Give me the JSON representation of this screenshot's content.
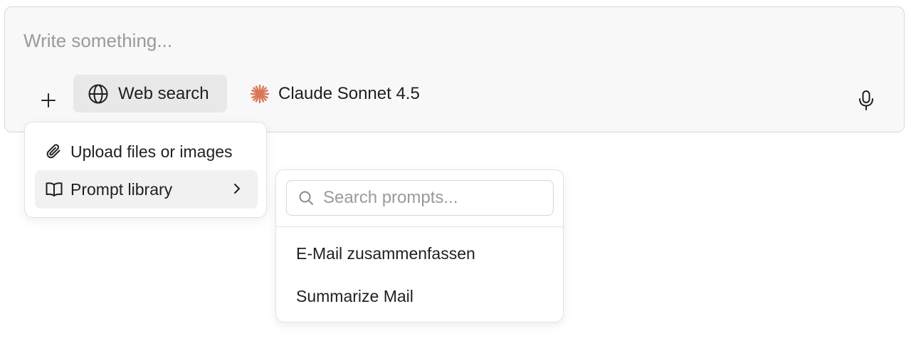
{
  "composer": {
    "placeholder": "Write something...",
    "value": ""
  },
  "toolbar": {
    "add_icon": "plus-icon",
    "web_search_label": "Web search",
    "web_search_icon": "globe-icon",
    "model_label": "Claude Sonnet 4.5",
    "model_icon": "claude-spark-icon",
    "model_icon_color": "#D97757",
    "mic_icon": "microphone-icon"
  },
  "attach_menu": {
    "items": [
      {
        "label": "Upload files or images",
        "icon": "paperclip-icon"
      },
      {
        "label": "Prompt library",
        "icon": "book-open-icon",
        "has_submenu": true
      }
    ]
  },
  "prompt_menu": {
    "search_placeholder": "Search prompts...",
    "search_value": "",
    "items": [
      {
        "label": "E-Mail zusammenfassen"
      },
      {
        "label": "Summarize Mail"
      }
    ]
  },
  "colors": {
    "composer_bg": "#f8f8f8",
    "active_button_bg": "#e8e8e8",
    "hover_item_bg": "#f1f1f1",
    "placeholder_text": "#9a9a9a"
  }
}
